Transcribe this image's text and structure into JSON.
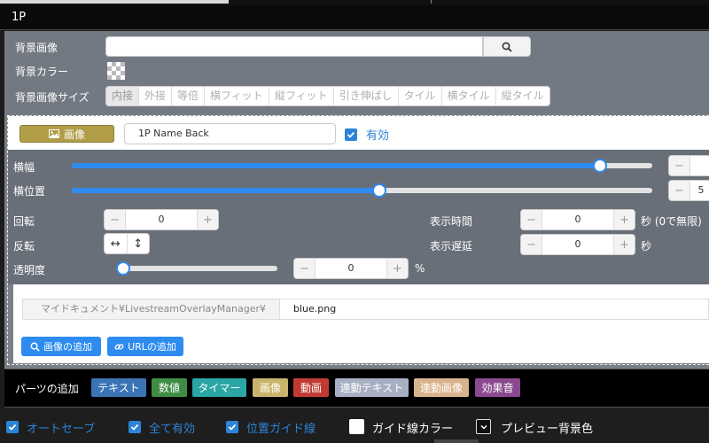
{
  "window": {
    "title": "1P"
  },
  "background": {
    "image_label": "背景画像",
    "image_value": "",
    "color_label": "背景カラー",
    "size_label": "背景画像サイズ",
    "size_options": [
      "内接",
      "外接",
      "等倍",
      "横フィット",
      "縦フィット",
      "引き伸ばし",
      "タイル",
      "横タイル",
      "縦タイル"
    ],
    "size_selected": "内接"
  },
  "layer": {
    "type_button": "画像",
    "name": "1P Name Back",
    "enabled_label": "有効",
    "enabled": true,
    "width_label": "横幅",
    "width_value_pct": 0.86,
    "xpos_label": "横位置",
    "xpos_value_pct": 0.53,
    "xpos_readout": "5",
    "rotation_label": "回転",
    "rotation_value": "0",
    "flip_label": "反転",
    "opacity_label": "透明度",
    "opacity_value": "0",
    "opacity_unit": "%",
    "display_time_label": "表示時間",
    "display_time_value": "0",
    "display_time_unit": "秒 (0で無限)",
    "display_delay_label": "表示遅延",
    "display_delay_value": "0",
    "display_delay_unit": "秒",
    "file_path": "マイドキュメント¥LivestreamOverlayManager¥",
    "file_name": "blue.png",
    "add_image_label": "画像の追加",
    "add_url_label": "URLの追加"
  },
  "parts": {
    "label": "パーツの追加",
    "buttons": [
      {
        "label": "テキスト",
        "color": "#3a74b5"
      },
      {
        "label": "数値",
        "color": "#3f8d44"
      },
      {
        "label": "タイマー",
        "color": "#2aa6a6"
      },
      {
        "label": "画像",
        "color": "#c8b46a"
      },
      {
        "label": "動画",
        "color": "#c23b33"
      },
      {
        "label": "連動テキスト",
        "color": "#a9afc2"
      },
      {
        "label": "連動画像",
        "color": "#d9b38c"
      },
      {
        "label": "効果音",
        "color": "#8b4a8f"
      }
    ]
  },
  "footer": {
    "autosave_label": "オートセーブ",
    "autosave": true,
    "all_enabled_label": "全て有効",
    "all_enabled": true,
    "guides_label": "位置ガイド線",
    "guides": true,
    "guide_color_label": "ガイド線カラー",
    "guide_color_checked": false,
    "preview_bg_label": "プレビュー背景色",
    "preview_bg_checked": false
  },
  "colors": {
    "accent": "#2e8bf0",
    "check": "#2b84d8"
  }
}
